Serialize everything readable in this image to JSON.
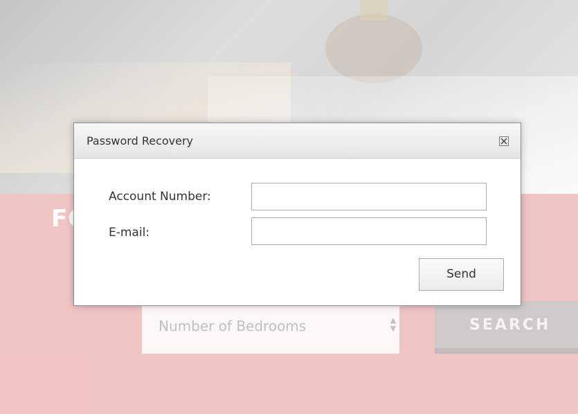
{
  "background": {
    "hero_text": "FOR RENT",
    "bedrooms_placeholder": "Number of Bedrooms",
    "search_label": "SEARCH"
  },
  "dialog": {
    "title": "Password Recovery",
    "fields": [
      {
        "label": "Account Number:",
        "value": ""
      },
      {
        "label": "E-mail:",
        "value": ""
      }
    ],
    "send_label": "Send"
  },
  "colors": {
    "accent_pink": "#f0bdbb",
    "dialog_border": "#8e8e8e"
  }
}
